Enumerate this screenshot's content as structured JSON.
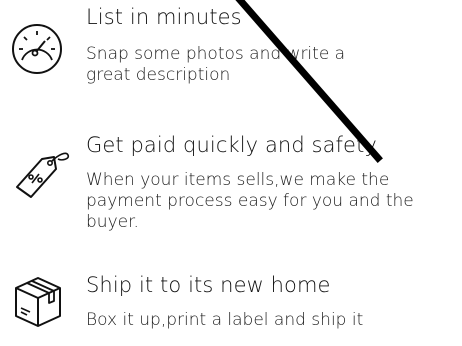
{
  "features": [
    {
      "icon": "speedometer-icon",
      "title": "List in minutes",
      "description": "Snap some photos and write a great description"
    },
    {
      "icon": "price-tag-icon",
      "title": "Get paid quickly and safety",
      "description": "When your items sells,we make the payment process easy for you and the buyer."
    },
    {
      "icon": "shipping-box-icon",
      "title": "Ship it to its new home",
      "description": "Box it up,print a label and ship it"
    }
  ]
}
